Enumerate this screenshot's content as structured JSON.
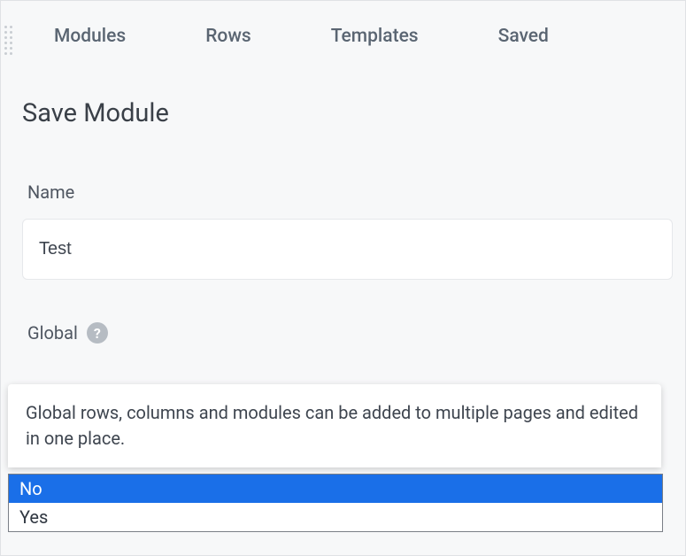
{
  "tabs": {
    "modules": "Modules",
    "rows": "Rows",
    "templates": "Templates",
    "saved": "Saved"
  },
  "heading": "Save Module",
  "form": {
    "name_label": "Name",
    "name_value": "Test",
    "global_label": "Global",
    "global_help": "?",
    "global_tooltip": "Global rows, columns and modules can be added to multiple pages and edited in one place.",
    "global_options": {
      "no": "No",
      "yes": "Yes"
    }
  }
}
